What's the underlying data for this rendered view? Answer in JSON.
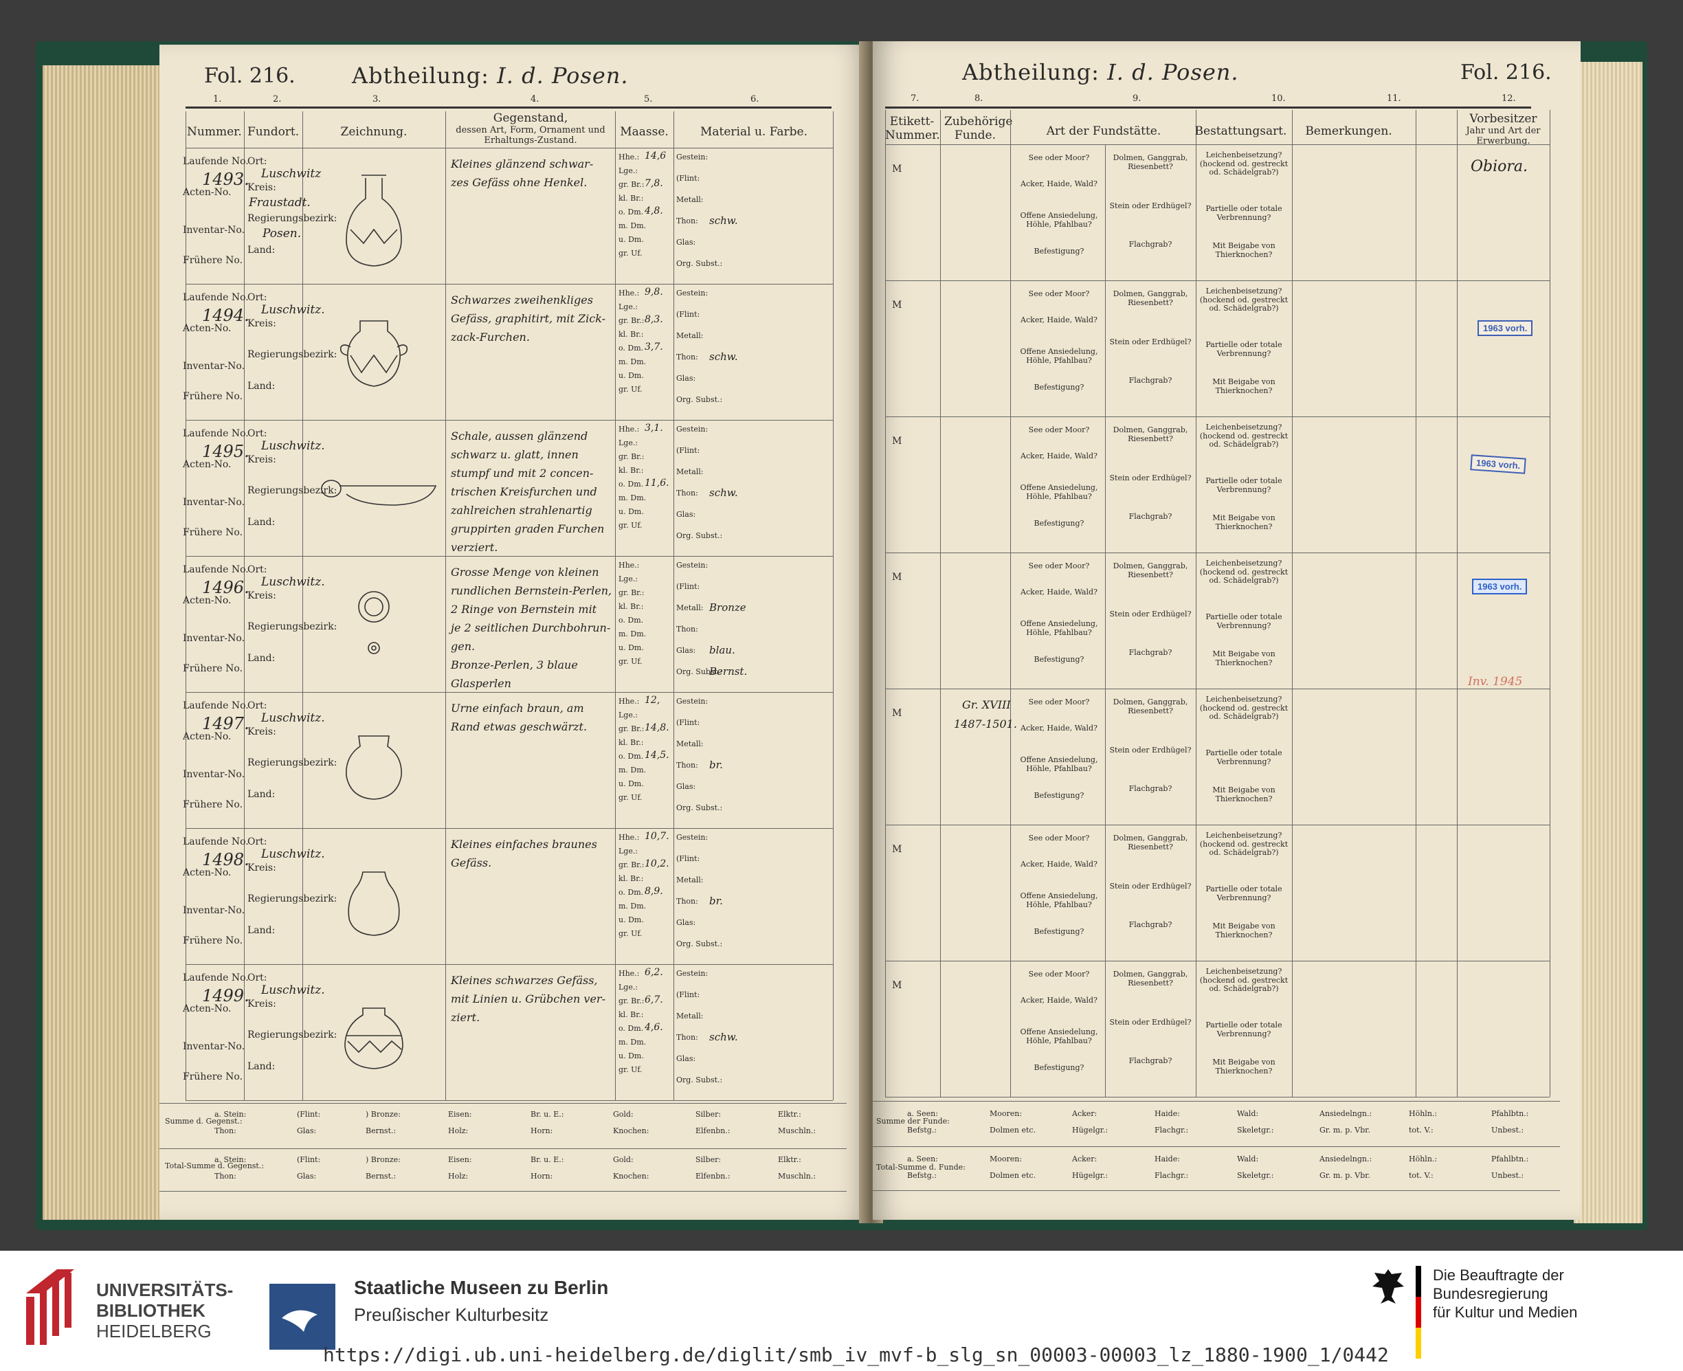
{
  "left_page": {
    "folio": "Fol. 216.",
    "abtheilung_label": "Abtheilung:",
    "abtheilung_value": "I. d. Posen.",
    "column_numbers": [
      "1.",
      "2.",
      "3.",
      "4.",
      "5.",
      "6."
    ],
    "headers": {
      "nummer": "Nummer.",
      "fundort": "Fundort.",
      "zeichnung": "Zeichnung.",
      "gegenstand_title": "Gegenstand,",
      "gegenstand_sub": "dessen Art, Form, Ornament und Erhaltungs-Zustand.",
      "maasse": "Maasse.",
      "material": "Material u. Farbe."
    },
    "row_labels": {
      "laufende": "Laufende No.",
      "acten": "Acten-No.",
      "inventar": "Inventar-No.",
      "fruehere": "Frühere No.",
      "ort": "Ort:",
      "kreis": "Kreis:",
      "regbez": "Regierungsbezirk:",
      "land": "Land:"
    },
    "measure_labels": [
      "Hhe.:",
      "Lge.:",
      "gr. Br.:",
      "kl. Br.:",
      "o. Dm.",
      "m. Dm.",
      "u. Dm.",
      "gr. Uf."
    ],
    "material_labels": [
      "Gestein:",
      "(Flint:",
      "Metall:",
      "Thon:",
      "Glas:",
      "Org. Subst.:"
    ],
    "entries": [
      {
        "number": "1493.",
        "ort": "Luschwitz",
        "kreis": "Fraustadt.",
        "regbez": "Posen.",
        "desc": [
          "Kleines glänzend schwar-",
          "zes Gefäss ohne Henkel."
        ],
        "measures": [
          "14,6",
          "",
          "7,8.",
          "",
          "4,8.",
          "",
          "",
          ""
        ],
        "materials": [
          "",
          "",
          "",
          "schw.",
          "",
          ""
        ]
      },
      {
        "number": "1494.",
        "ort": "Luschwitz.",
        "kreis": "",
        "regbez": "",
        "desc": [
          "Schwarzes zweihenkliges",
          "Gefäss, graphitirt, mit Zick-",
          "zack-Furchen."
        ],
        "measures": [
          "9,8.",
          "",
          "8,3.",
          "",
          "3,7.",
          "",
          "",
          ""
        ],
        "materials": [
          "",
          "",
          "",
          "schw.",
          "",
          ""
        ]
      },
      {
        "number": "1495.",
        "ort": "Luschwitz.",
        "kreis": "",
        "regbez": "",
        "desc": [
          "Schale, aussen glänzend",
          "schwarz u. glatt, innen",
          "stumpf und mit 2 concen-",
          "trischen Kreisfurchen und",
          "zahlreichen strahlenartig",
          "gruppirten graden Furchen",
          "verziert."
        ],
        "measures": [
          "3,1.",
          "",
          "",
          "",
          "11,6.",
          "",
          "",
          ""
        ],
        "materials": [
          "",
          "",
          "",
          "schw.",
          "",
          ""
        ]
      },
      {
        "number": "1496.",
        "ort": "Luschwitz.",
        "kreis": "",
        "regbez": "",
        "desc": [
          "Grosse Menge von kleinen",
          "rundlichen Bernstein-Perlen,",
          "2 Ringe von Bernstein mit",
          "je 2 seitlichen Durchbohrun-",
          "gen.",
          "Bronze-Perlen, 3 blaue Glasperlen"
        ],
        "measures": [
          "",
          "",
          "",
          "",
          "",
          "",
          "",
          ""
        ],
        "materials": [
          "",
          "",
          "Bronze",
          "",
          "blau.",
          "Bernst."
        ]
      },
      {
        "number": "1497.",
        "ort": "Luschwitz.",
        "kreis": "",
        "regbez": "",
        "desc": [
          "Urne einfach braun, am",
          "Rand etwas geschwärzt."
        ],
        "measures": [
          "12,",
          "",
          "14,8.",
          "",
          "14,5.",
          "",
          "",
          ""
        ],
        "materials": [
          "",
          "",
          "",
          "br.",
          "",
          ""
        ]
      },
      {
        "number": "1498.",
        "ort": "Luschwitz.",
        "kreis": "",
        "regbez": "",
        "desc": [
          "Kleines einfaches braunes",
          "Gefäss."
        ],
        "measures": [
          "10,7.",
          "",
          "10,2.",
          "",
          "8,9.",
          "",
          "",
          ""
        ],
        "materials": [
          "",
          "",
          "",
          "br.",
          "",
          ""
        ]
      },
      {
        "number": "1499.",
        "ort": "Luschwitz.",
        "kreis": "",
        "regbez": "",
        "desc": [
          "Kleines schwarzes Gefäss,",
          "mit Linien u. Grübchen ver-",
          "ziert."
        ],
        "measures": [
          "6,2.",
          "",
          "6,7.",
          "",
          "4,6.",
          "",
          "",
          ""
        ],
        "materials": [
          "",
          "",
          "",
          "schw.",
          "",
          ""
        ]
      }
    ],
    "summe_label": "Summe d. Gegenst.:",
    "total_label": "Total-Summe d. Gegenst.:",
    "summe_row1": [
      "a. Stein:",
      "(Flint:",
      ") Bronze:",
      "Eisen:",
      "Br. u. E.:",
      "Gold:",
      "Silber:",
      "Elktr.:"
    ],
    "summe_row2": [
      "Thon:",
      "Glas:",
      "Bernst.:",
      "Holz:",
      "Horn:",
      "Knochen:",
      "Elfenbn.:",
      "Muschln.:"
    ]
  },
  "right_page": {
    "folio": "Fol. 216.",
    "abtheilung_label": "Abtheilung:",
    "abtheilung_value": "I. d. Posen.",
    "column_numbers": [
      "7.",
      "8.",
      "9.",
      "10.",
      "11.",
      "12."
    ],
    "headers": {
      "etikett": "Etikett-Nummer.",
      "zubehoerige": "Zubehörige Funde.",
      "fundstaette": "Art der Fundstätte.",
      "bestattung": "Bestattungsart.",
      "bemerkungen": "Bemerkungen.",
      "vorbesitzer": "Vorbesitzer",
      "vorbesitzer_sub": "Jahr und Art der Erwerbung."
    },
    "etikett_mark": "M",
    "fundstaette_a": [
      "See oder Moor?",
      "Acker, Haide, Wald?",
      "Offene Ansiedelung, Höhle, Pfahlbau?",
      "Befestigung?"
    ],
    "fundstaette_b": [
      "Dolmen, Ganggrab, Riesenbett?",
      "Stein oder Erdhügel?",
      "Flachgrab?"
    ],
    "bestattung": [
      "Leichenbeisetzung? (hockend od. gestreckt od. Schädelgrab?)",
      "Partielle oder totale Verbrennung?",
      "Mit Beigabe von Thierknochen?"
    ],
    "vorbesitzer_entry": "Obiora.",
    "stamps": [
      "1963 vorh.",
      "1963 vorh.",
      "1963 vorh."
    ],
    "red_note": "Inv. 1945",
    "zubehoerige_note_1": "Gr. XVIII",
    "zubehoerige_note_2": "1487-1501.",
    "summe_label": "Summe der Funde:",
    "total_label": "Total-Summe d. Funde:",
    "summe_row1": [
      "a. Seen:",
      "Mooren:",
      "Acker:",
      "Haide:",
      "Wald:",
      "Ansiedelngn.:",
      "Höhln.:",
      "Pfahlbtn.:"
    ],
    "summe_row2": [
      "Befstg.:",
      "Dolmen etc.",
      "Hügelgr.:",
      "Flachgr.:",
      "Skeletgr.:",
      "Gr. m. p. Vbr.",
      "tot. V.:",
      "Unbest.:"
    ]
  },
  "footer": {
    "ub_line1": "UNIVERSITÄTS-",
    "ub_line2": "BIBLIOTHEK",
    "ub_line3": "HEIDELBERG",
    "smb_title": "Staatliche Museen zu Berlin",
    "smb_sub": "Preußischer Kulturbesitz",
    "bkm_line1": "Die Beauftragte der Bundesregierung",
    "bkm_line2": "für Kultur und Medien",
    "url": "https://digi.ub.uni-heidelberg.de/diglit/smb_iv_mvf-b_slg_sn_00003-00003_lz_1880-1900_1/0442"
  },
  "colors": {
    "paper": "#efe6d1",
    "ink": "#2a2a2a",
    "stamp_blue": "#3b5fb5",
    "red_note": "#d07060",
    "smb_blue": "#2c4f86",
    "ub_red": "#c0262d"
  }
}
